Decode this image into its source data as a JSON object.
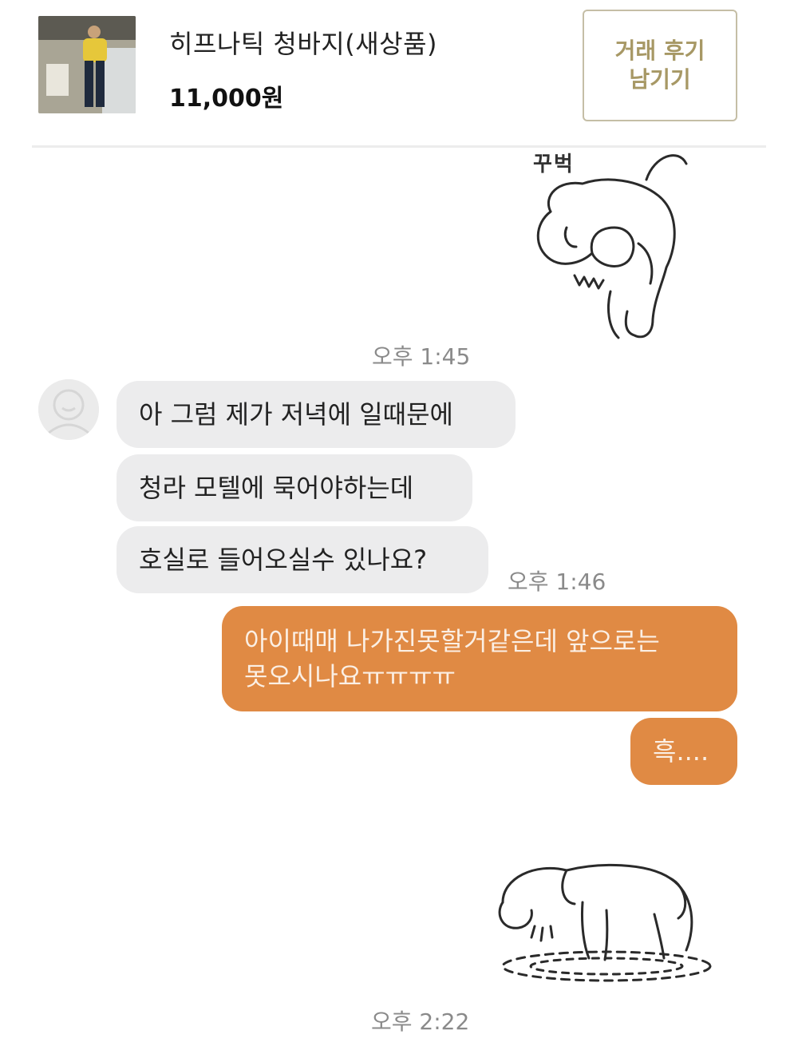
{
  "product": {
    "title": "히프나틱 청바지(새상품)",
    "price": "11,000원",
    "review_button": {
      "line1": "거래 후기",
      "line2": "남기기"
    }
  },
  "stickers": {
    "first": {
      "caption": "꾸벅",
      "icon": "bowing-bunny-sticker"
    },
    "second": {
      "icon": "crying-bunny-sticker"
    }
  },
  "messages": {
    "timestamp_1": "오후 1:45",
    "incoming": [
      "아 그럼 제가 저녁에 일때문에",
      "청라 모텔에 묵어야하는데",
      "호실로 들어오실수 있나요?"
    ],
    "timestamp_2": "오후 1:46",
    "outgoing": [
      {
        "line1": "아이때매 나가진못할거같은데 앞으로는",
        "line2": "못오시나요ㅠㅠㅠㅠ"
      },
      {
        "line1": "흑...."
      }
    ],
    "timestamp_3": "오후 2:22"
  },
  "colors": {
    "outgoing_bubble": "#e08a44",
    "incoming_bubble": "#ececed",
    "review_button_text": "#a79865"
  }
}
